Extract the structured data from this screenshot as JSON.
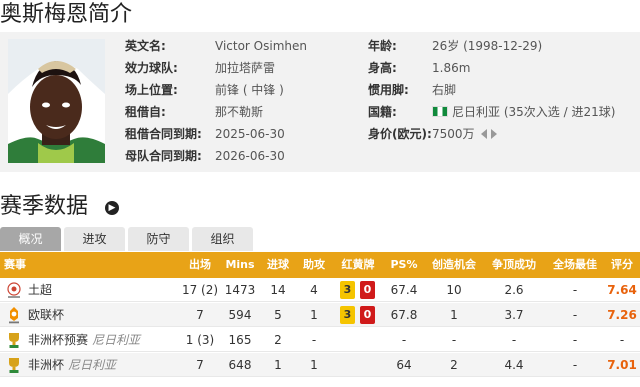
{
  "page": {
    "title": "奥斯梅恩简介",
    "season_title": "赛季数据"
  },
  "profile": {
    "left": [
      {
        "key": "英文名:",
        "value": "Victor Osimhen"
      },
      {
        "key": "效力球队:",
        "value": "加拉塔萨雷"
      },
      {
        "key": "场上位置:",
        "value": "前锋 ( 中锋 )"
      },
      {
        "key": "租借自:",
        "value": "那不勒斯"
      },
      {
        "key": "租借合同到期:",
        "value": "2025-06-30"
      },
      {
        "key": "母队合同到期:",
        "value": "2026-06-30"
      }
    ],
    "right": [
      {
        "key": "年龄:",
        "value": "26岁  (1998-12-29)"
      },
      {
        "key": "身高:",
        "value": "1.86m"
      },
      {
        "key": "惯用脚:",
        "value": "右脚"
      },
      {
        "key": "国籍:",
        "value": "尼日利亚 (35次入选 / 进21球)"
      },
      {
        "key": "身价(欧元):",
        "value": "7500万"
      }
    ]
  },
  "tabs": [
    "概况",
    "进攻",
    "防守",
    "组织"
  ],
  "active_tab": "概况",
  "table": {
    "headers": [
      "赛事",
      "出场",
      "Mins",
      "进球",
      "助攻",
      "红黄牌",
      "PS%",
      "创造机会",
      "争顶成功",
      "全场最佳",
      "评分"
    ],
    "rows": [
      {
        "comp": "土超",
        "sub": "",
        "apps": "17 (2)",
        "mins": "1473",
        "goals": "14",
        "assists": "4",
        "yellow": "3",
        "red": "0",
        "ps": "67.4",
        "chances": "10",
        "aerials": "2.6",
        "motm": "-",
        "rating": "7.64"
      },
      {
        "comp": "欧联杯",
        "sub": "",
        "apps": "7",
        "mins": "594",
        "goals": "5",
        "assists": "1",
        "yellow": "3",
        "red": "0",
        "ps": "67.8",
        "chances": "1",
        "aerials": "3.7",
        "motm": "-",
        "rating": "7.26"
      },
      {
        "comp": "非洲杯预赛",
        "sub": "尼日利亚",
        "apps": "1 (3)",
        "mins": "165",
        "goals": "2",
        "assists": "-",
        "yellow": "",
        "red": "",
        "ps": "-",
        "chances": "-",
        "aerials": "-",
        "motm": "-",
        "rating": "-"
      },
      {
        "comp": "非洲杯",
        "sub": "尼日利亚",
        "apps": "7",
        "mins": "648",
        "goals": "1",
        "assists": "1",
        "yellow": "",
        "red": "",
        "ps": "64",
        "chances": "2",
        "aerials": "4.4",
        "motm": "-",
        "rating": "7.01"
      }
    ]
  },
  "colors": {
    "accent": "#e8a317",
    "rating": "#e8620c",
    "yellow_card": "#f5c400",
    "red_card": "#d01a1a",
    "flag": "#118a3c"
  },
  "icons": {
    "nationality": "nigeria-flag-icon",
    "value_trend": "left-right-arrows-icon",
    "go": "arrow-right-circle-icon"
  }
}
